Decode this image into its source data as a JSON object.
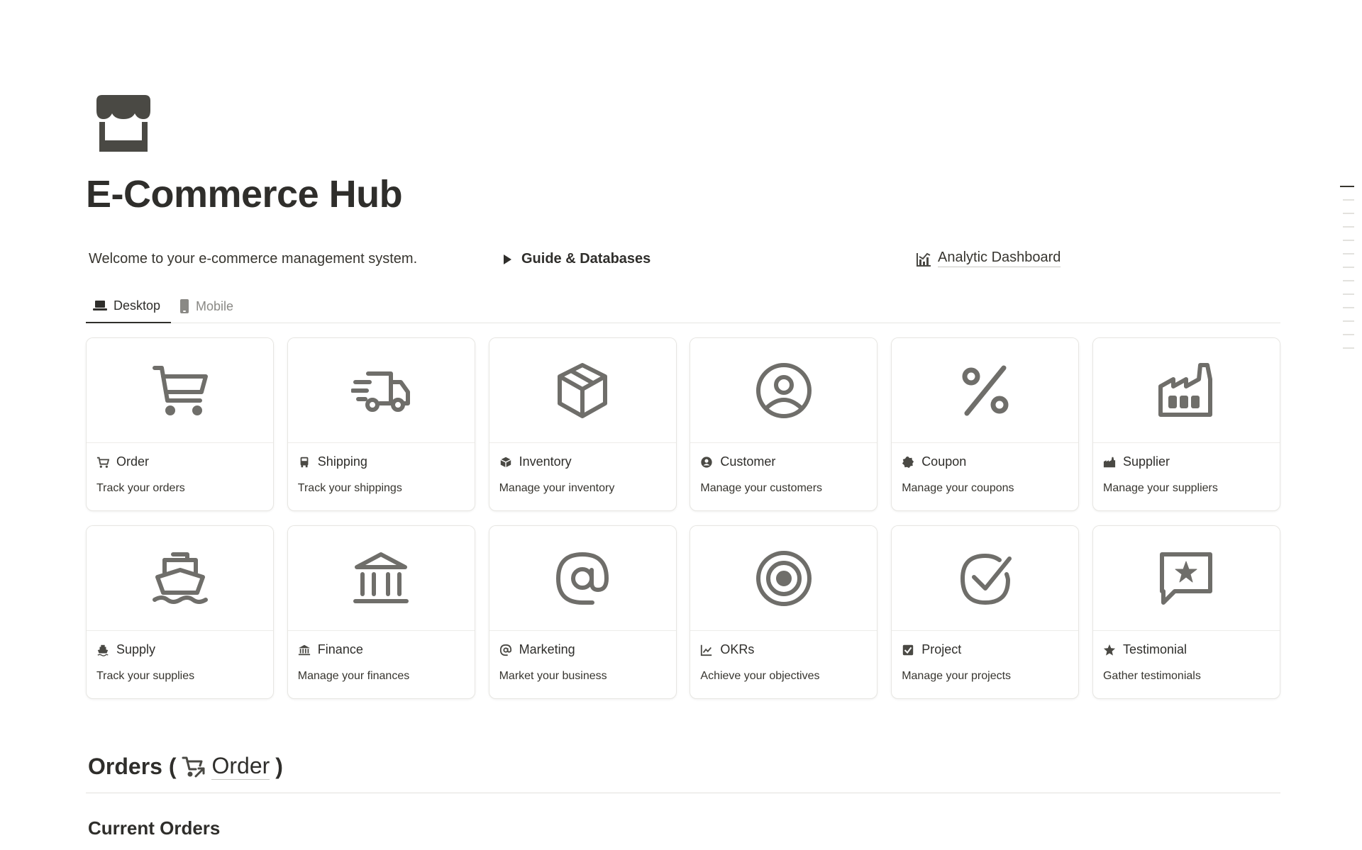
{
  "page": {
    "title": "E-Commerce Hub",
    "icon": "storefront-icon",
    "welcome": "Welcome to your e-commerce management system.",
    "guide_toggle": "Guide & Databases",
    "dashboard_link": "Analytic Dashboard"
  },
  "tabs": [
    {
      "label": "Desktop",
      "icon": "laptop-icon",
      "active": true
    },
    {
      "label": "Mobile",
      "icon": "phone-icon",
      "active": false
    }
  ],
  "cards": [
    {
      "title": "Order",
      "desc": "Track your orders",
      "icon": "cart-icon"
    },
    {
      "title": "Shipping",
      "desc": "Track your shippings",
      "icon": "truck-icon"
    },
    {
      "title": "Inventory",
      "desc": "Manage your inventory",
      "icon": "box-icon"
    },
    {
      "title": "Customer",
      "desc": "Manage your customers",
      "icon": "user-circle-icon"
    },
    {
      "title": "Coupon",
      "desc": "Manage your coupons",
      "icon": "percent-icon"
    },
    {
      "title": "Supplier",
      "desc": "Manage your suppliers",
      "icon": "factory-icon"
    },
    {
      "title": "Supply",
      "desc": "Track your supplies",
      "icon": "ship-icon"
    },
    {
      "title": "Finance",
      "desc": "Manage your finances",
      "icon": "bank-icon"
    },
    {
      "title": "Marketing",
      "desc": "Market your business",
      "icon": "at-icon"
    },
    {
      "title": "OKRs",
      "desc": "Achieve your objectives",
      "icon": "target-icon"
    },
    {
      "title": "Project",
      "desc": "Manage your projects",
      "icon": "check-circle-icon"
    },
    {
      "title": "Testimonial",
      "desc": "Gather testimonials",
      "icon": "star-message-icon"
    }
  ],
  "section": {
    "heading_prefix": "Orders (",
    "heading_link": "Order",
    "heading_suffix": ")",
    "subheading": "Current Orders"
  },
  "colors": {
    "text": "#37352f",
    "icon": "#6f6e6a",
    "icon_dark": "#4a4944",
    "border": "#e7e6e2"
  }
}
